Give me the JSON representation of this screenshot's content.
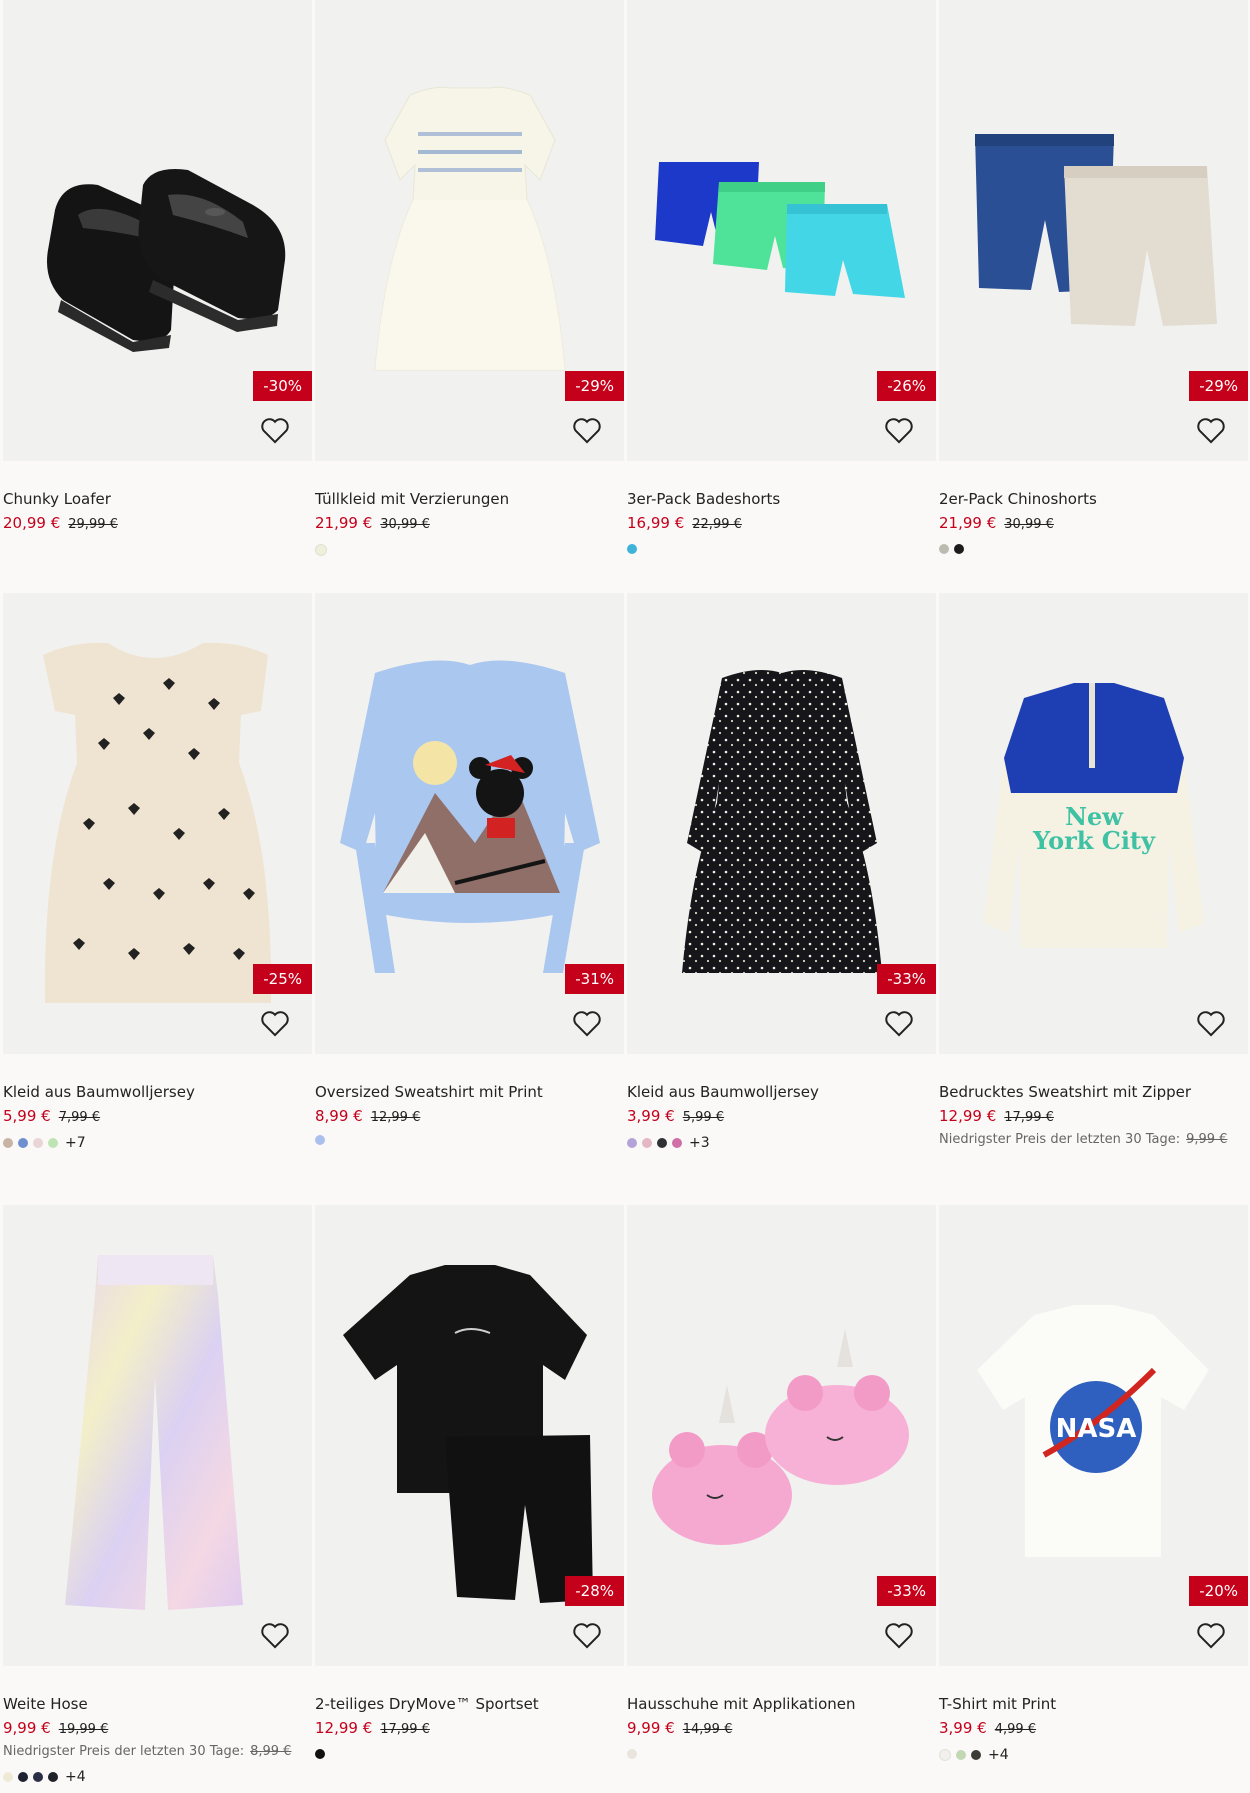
{
  "products": [
    {
      "title": "Chunky Loafer",
      "price": "20,99 €",
      "old_price": "29,99 €",
      "discount": "-30%",
      "swatches": [],
      "more": "",
      "lowest_label": "",
      "lowest_price": "",
      "image": "black-patent-loafers"
    },
    {
      "title": "Tüllkleid mit Verzierungen",
      "price": "21,99 €",
      "old_price": "30,99 €",
      "discount": "-29%",
      "swatches": [
        "#eef0dc"
      ],
      "more": "",
      "lowest_label": "",
      "lowest_price": "",
      "image": "cream-tulle-dress"
    },
    {
      "title": "3er-Pack Badeshorts",
      "price": "16,99 €",
      "old_price": "22,99 €",
      "discount": "-26%",
      "swatches": [
        "#3fb3d8"
      ],
      "more": "",
      "lowest_label": "",
      "lowest_price": "",
      "image": "swim-shorts-three-pack"
    },
    {
      "title": "2er-Pack Chinoshorts",
      "price": "21,99 €",
      "old_price": "30,99 €",
      "discount": "-29%",
      "swatches": [
        "#b9bcae",
        "#1c1c1c"
      ],
      "more": "",
      "lowest_label": "",
      "lowest_price": "",
      "image": "chino-shorts-two-pack"
    },
    {
      "title": "Kleid aus Baumwolljersey",
      "price": "5,99 €",
      "old_price": "7,99 €",
      "discount": "-25%",
      "swatches": [
        "#c9b2a6",
        "#6f8fcf",
        "#ead5d6",
        "#bfe4b4"
      ],
      "more": "+7",
      "lowest_label": "",
      "lowest_price": "",
      "image": "heart-print-dress"
    },
    {
      "title": "Oversized Sweatshirt mit Print",
      "price": "8,99 €",
      "old_price": "12,99 €",
      "discount": "-31%",
      "swatches": [
        "#a9c0ec"
      ],
      "more": "",
      "lowest_label": "",
      "lowest_price": "",
      "image": "mickey-sweatshirt"
    },
    {
      "title": "Kleid aus Baumwolljersey",
      "price": "3,99 €",
      "old_price": "5,99 €",
      "discount": "-33%",
      "swatches": [
        "#b4a3d9",
        "#e3b8c2",
        "#2f3135",
        "#d06fa6"
      ],
      "more": "+3",
      "lowest_label": "",
      "lowest_price": "",
      "image": "floral-black-dress"
    },
    {
      "title": "Bedrucktes Sweatshirt mit Zipper",
      "price": "12,99 €",
      "old_price": "17,99 €",
      "discount": "",
      "swatches": [],
      "more": "",
      "lowest_label": "Niedrigster Preis der letzten 30 Tage:",
      "lowest_price": "9,99 €",
      "image": "new-york-half-zip"
    },
    {
      "title": "Weite Hose",
      "price": "9,99 €",
      "old_price": "19,99 €",
      "discount": "",
      "swatches": [
        "#efe9d8",
        "#1e2230",
        "#2b2f44",
        "#1f2329"
      ],
      "more": "+4",
      "lowest_label": "Niedrigster Preis der letzten 30 Tage:",
      "lowest_price": "8,99 €",
      "image": "tie-dye-wide-trousers"
    },
    {
      "title": "2-teiliges DryMove™ Sportset",
      "price": "12,99 €",
      "old_price": "17,99 €",
      "discount": "-28%",
      "swatches": [
        "#111111"
      ],
      "more": "",
      "lowest_label": "",
      "lowest_price": "",
      "image": "black-sport-set"
    },
    {
      "title": "Hausschuhe mit Applikationen",
      "price": "9,99 €",
      "old_price": "14,99 €",
      "discount": "-33%",
      "swatches": [
        "#e9e4dc"
      ],
      "more": "",
      "lowest_label": "",
      "lowest_price": "",
      "image": "unicorn-slippers"
    },
    {
      "title": "T-Shirt mit Print",
      "price": "3,99 €",
      "old_price": "4,99 €",
      "discount": "-20%",
      "swatches": [
        "#f1f0ec",
        "#c4d7b5",
        "#3c3c36"
      ],
      "more": "+4",
      "lowest_label": "",
      "lowest_price": "",
      "image": "nasa-tshirt"
    }
  ],
  "icons": {
    "favorite": "heart-outline-icon"
  }
}
